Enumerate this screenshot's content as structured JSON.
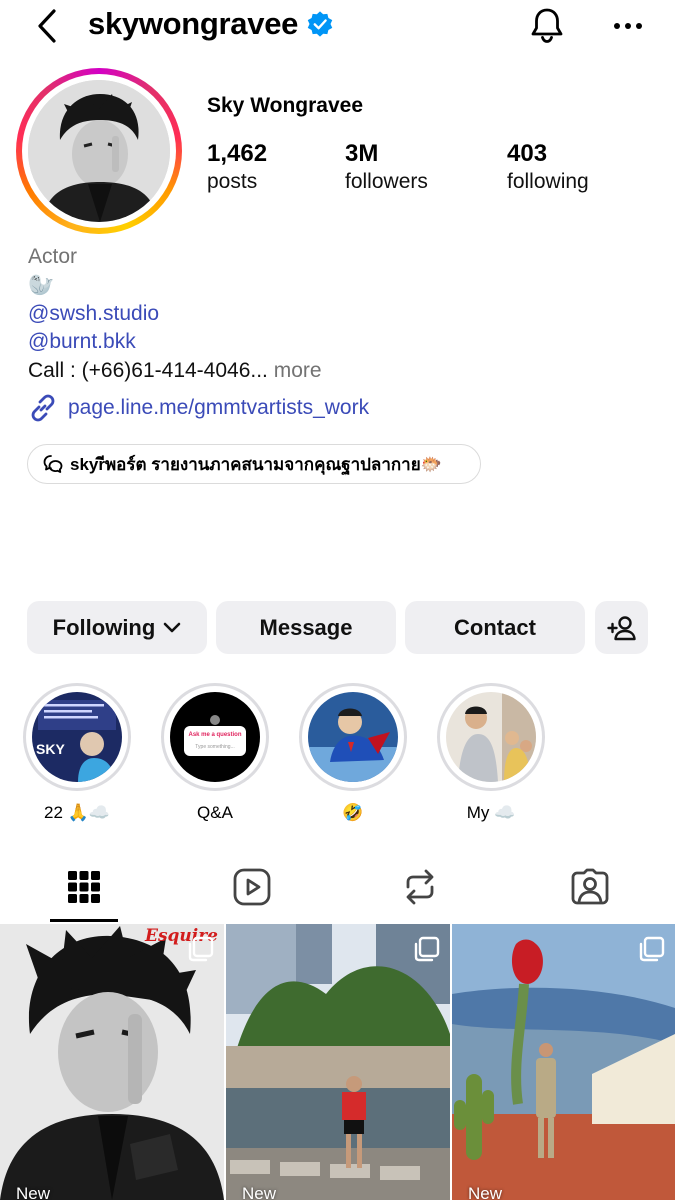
{
  "header": {
    "username": "skywongravee",
    "verified": true,
    "icons": [
      "back-chevron-icon",
      "verified-badge-icon",
      "bell-icon",
      "more-dots-icon"
    ]
  },
  "profile": {
    "display_name": "Sky Wongravee",
    "stats": [
      {
        "value": "1,462",
        "label": "posts"
      },
      {
        "value": "3M",
        "label": "followers"
      },
      {
        "value": "403",
        "label": "following"
      }
    ]
  },
  "bio": {
    "category": "Actor",
    "emoji": "🦭",
    "mentions": [
      "@swsh.studio",
      "@burnt.bkk"
    ],
    "call_text": "Call : (+66)61-414-4046...",
    "more_label": "more",
    "link": "page.line.me/gmmtvartists_work"
  },
  "threads_pill": {
    "text": "skyrีพอร์ต รายงานภาคสนามจากคุณฐาปลากาย🐡"
  },
  "actions": {
    "following": "Following",
    "message": "Message",
    "contact": "Contact"
  },
  "highlights": [
    {
      "label": "22 🙏☁️"
    },
    {
      "label": "Q&A"
    },
    {
      "label": "🤣"
    },
    {
      "label": "My ☁️"
    }
  ],
  "highlight_texts": {
    "qa_prompt": "Ask me a question",
    "qa_input": "Type something...",
    "sky_word": "SKY"
  },
  "post_overlay": {
    "magazine": "Esquire"
  },
  "tabs": [
    "posts-grid",
    "reels",
    "reposts",
    "tagged"
  ],
  "posts": [
    {
      "badge": "New"
    },
    {
      "badge": "New"
    },
    {
      "badge": "New"
    }
  ],
  "colors": {
    "accent_link": "#3b4bb8",
    "verified": "#0095f6",
    "button_bg": "#efeff2"
  }
}
